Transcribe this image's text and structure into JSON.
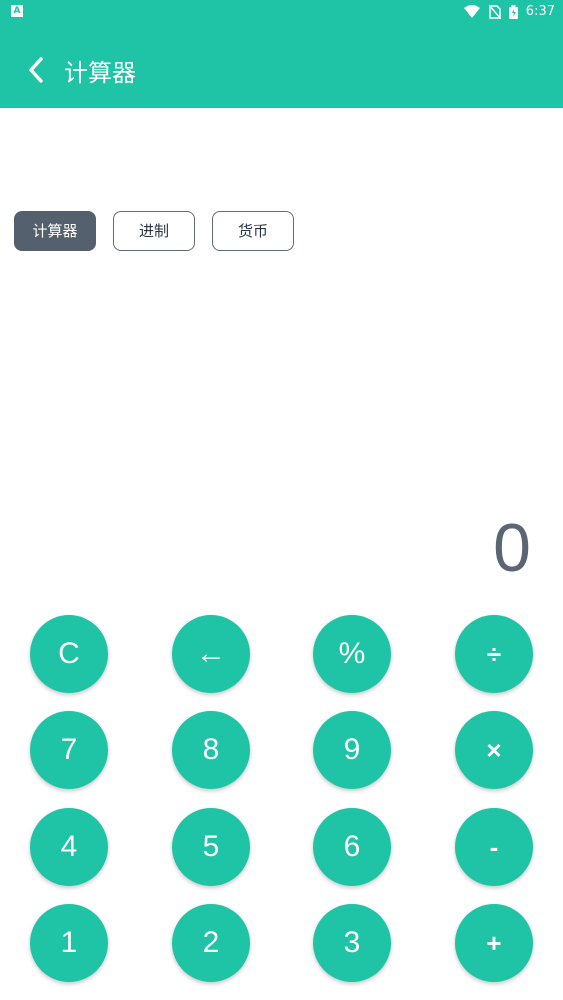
{
  "status_bar": {
    "left_icon_label": "A",
    "time": "6:37",
    "icons": [
      "wifi-icon",
      "no-sim-icon",
      "battery-icon"
    ]
  },
  "app_bar": {
    "back_icon": "chevron-left-icon",
    "title": "计算器"
  },
  "mode_tabs": [
    {
      "label": "计算器",
      "active": true
    },
    {
      "label": "进制",
      "active": false
    },
    {
      "label": "货币",
      "active": false
    }
  ],
  "display": {
    "value": "0"
  },
  "keypad": {
    "rows": [
      [
        "C",
        "←",
        "%",
        "÷"
      ],
      [
        "7",
        "8",
        "9",
        "×"
      ],
      [
        "4",
        "5",
        "6",
        "-"
      ],
      [
        "1",
        "2",
        "3",
        "+"
      ]
    ]
  },
  "colors": {
    "accent": "#1fc3a6",
    "active_tab": "#54606d",
    "display_text": "#5a6674"
  }
}
